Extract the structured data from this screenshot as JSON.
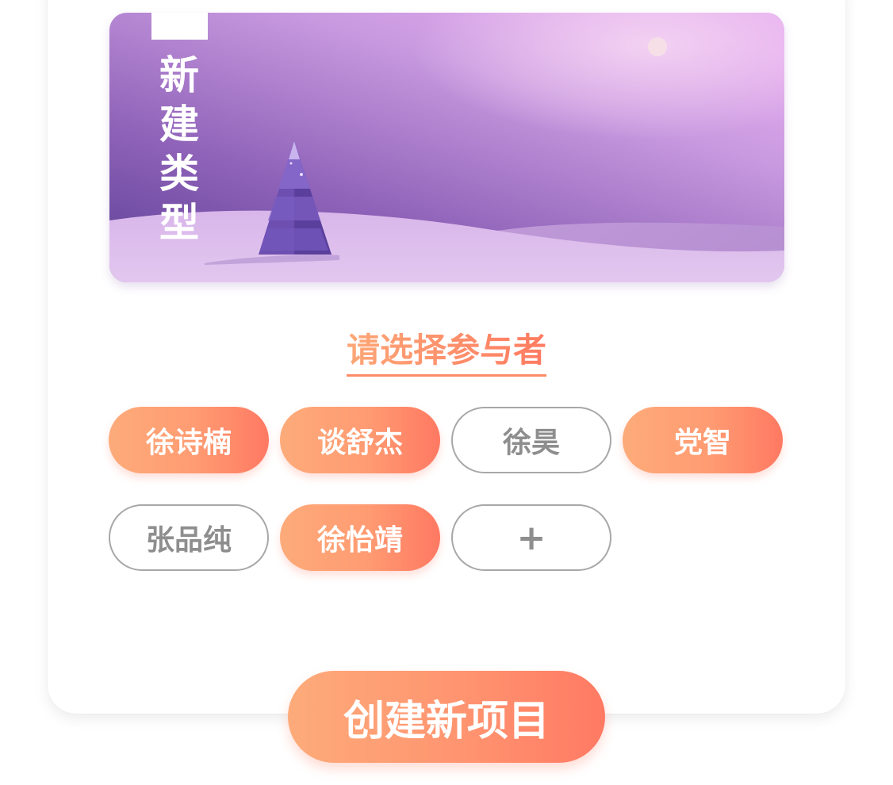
{
  "banner": {
    "title_chars": [
      "新",
      "建",
      "类",
      "型"
    ],
    "illustration": "purple-snow-landscape-with-pine-tree"
  },
  "participants": {
    "title": "请选择参与者",
    "people": [
      {
        "name": "徐诗楠",
        "selected": true
      },
      {
        "name": "谈舒杰",
        "selected": true
      },
      {
        "name": "徐昊",
        "selected": false
      },
      {
        "name": "党智",
        "selected": true
      },
      {
        "name": "张品纯",
        "selected": false
      },
      {
        "name": "徐怡靖",
        "selected": true
      }
    ],
    "add_label": "+"
  },
  "actions": {
    "create_label": "创建新项目"
  },
  "colors": {
    "accent_start": "#fdab7a",
    "accent_end": "#ff7962",
    "unselected_border": "#a8a8a8",
    "unselected_text": "#8e8e8e",
    "banner_purple": "#9a6cc4"
  }
}
